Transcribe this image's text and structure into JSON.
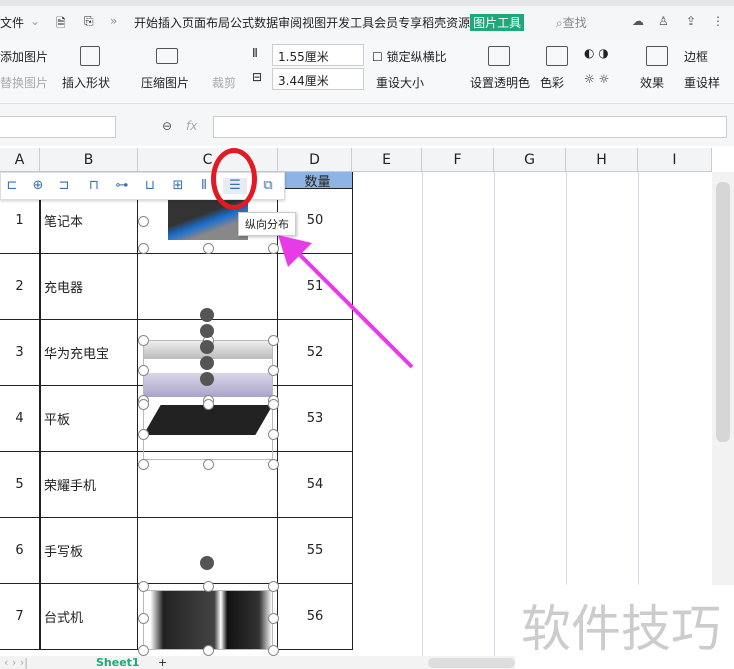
{
  "menu": {
    "file": "文件",
    "tabs": [
      "开始",
      "插入",
      "页面布局",
      "公式",
      "数据",
      "审阅",
      "视图",
      "开发工具",
      "会员专享",
      "稻壳资源"
    ],
    "active_tab": "图片工具",
    "search": "查找"
  },
  "ribbon": {
    "add_picture": "添加图片",
    "replace_picture": "替换图片",
    "insert_shape": "插入形状",
    "compress": "压缩图片",
    "crop": "裁剪",
    "height": "1.55厘米",
    "width": "3.44厘米",
    "lock_ratio": "锁定纵横比",
    "reset_size": "重设大小",
    "set_transparent": "设置透明色",
    "color": "色彩",
    "effects": "效果",
    "border": "边框",
    "reset_picture": "重设样"
  },
  "formula": {
    "fx": "fx"
  },
  "columns": [
    "A",
    "B",
    "C",
    "D",
    "E",
    "F",
    "G",
    "H",
    "I"
  ],
  "header_d": "数量",
  "rows": [
    {
      "n": "1",
      "name": "笔记本",
      "qty": "50"
    },
    {
      "n": "2",
      "name": "充电器",
      "qty": "51"
    },
    {
      "n": "3",
      "name": "华为充电宝",
      "qty": "52"
    },
    {
      "n": "4",
      "name": "平板",
      "qty": "53"
    },
    {
      "n": "5",
      "name": "荣耀手机",
      "qty": "54"
    },
    {
      "n": "6",
      "name": "手写板",
      "qty": "55"
    },
    {
      "n": "7",
      "name": "台式机",
      "qty": "56"
    }
  ],
  "tooltip": "纵向分布",
  "sheet_tab": "Sheet1",
  "watermark": "软件技巧",
  "colors": {
    "accent": "#1fa87a",
    "annotation": "#e01b24",
    "arrow": "#e83be8"
  }
}
